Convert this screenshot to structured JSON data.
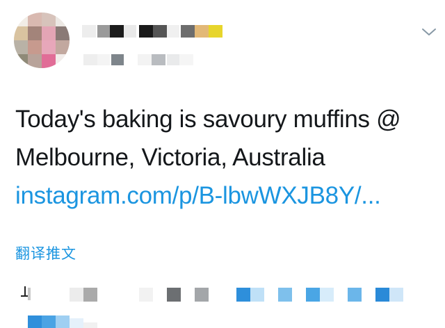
{
  "tweet": {
    "text": "Today's baking is savoury muffins @ Melbourne, Victoria, Australia",
    "link": "instagram.com/p/B-lbwWXJB8Y/...",
    "translate_label": "翻译推文"
  },
  "icons": {
    "menu": "chevron-down-icon",
    "avatar": "avatar-image-pixelated"
  },
  "colors": {
    "text": "#14171a",
    "link": "#1b95e0",
    "background": "#ffffff"
  }
}
